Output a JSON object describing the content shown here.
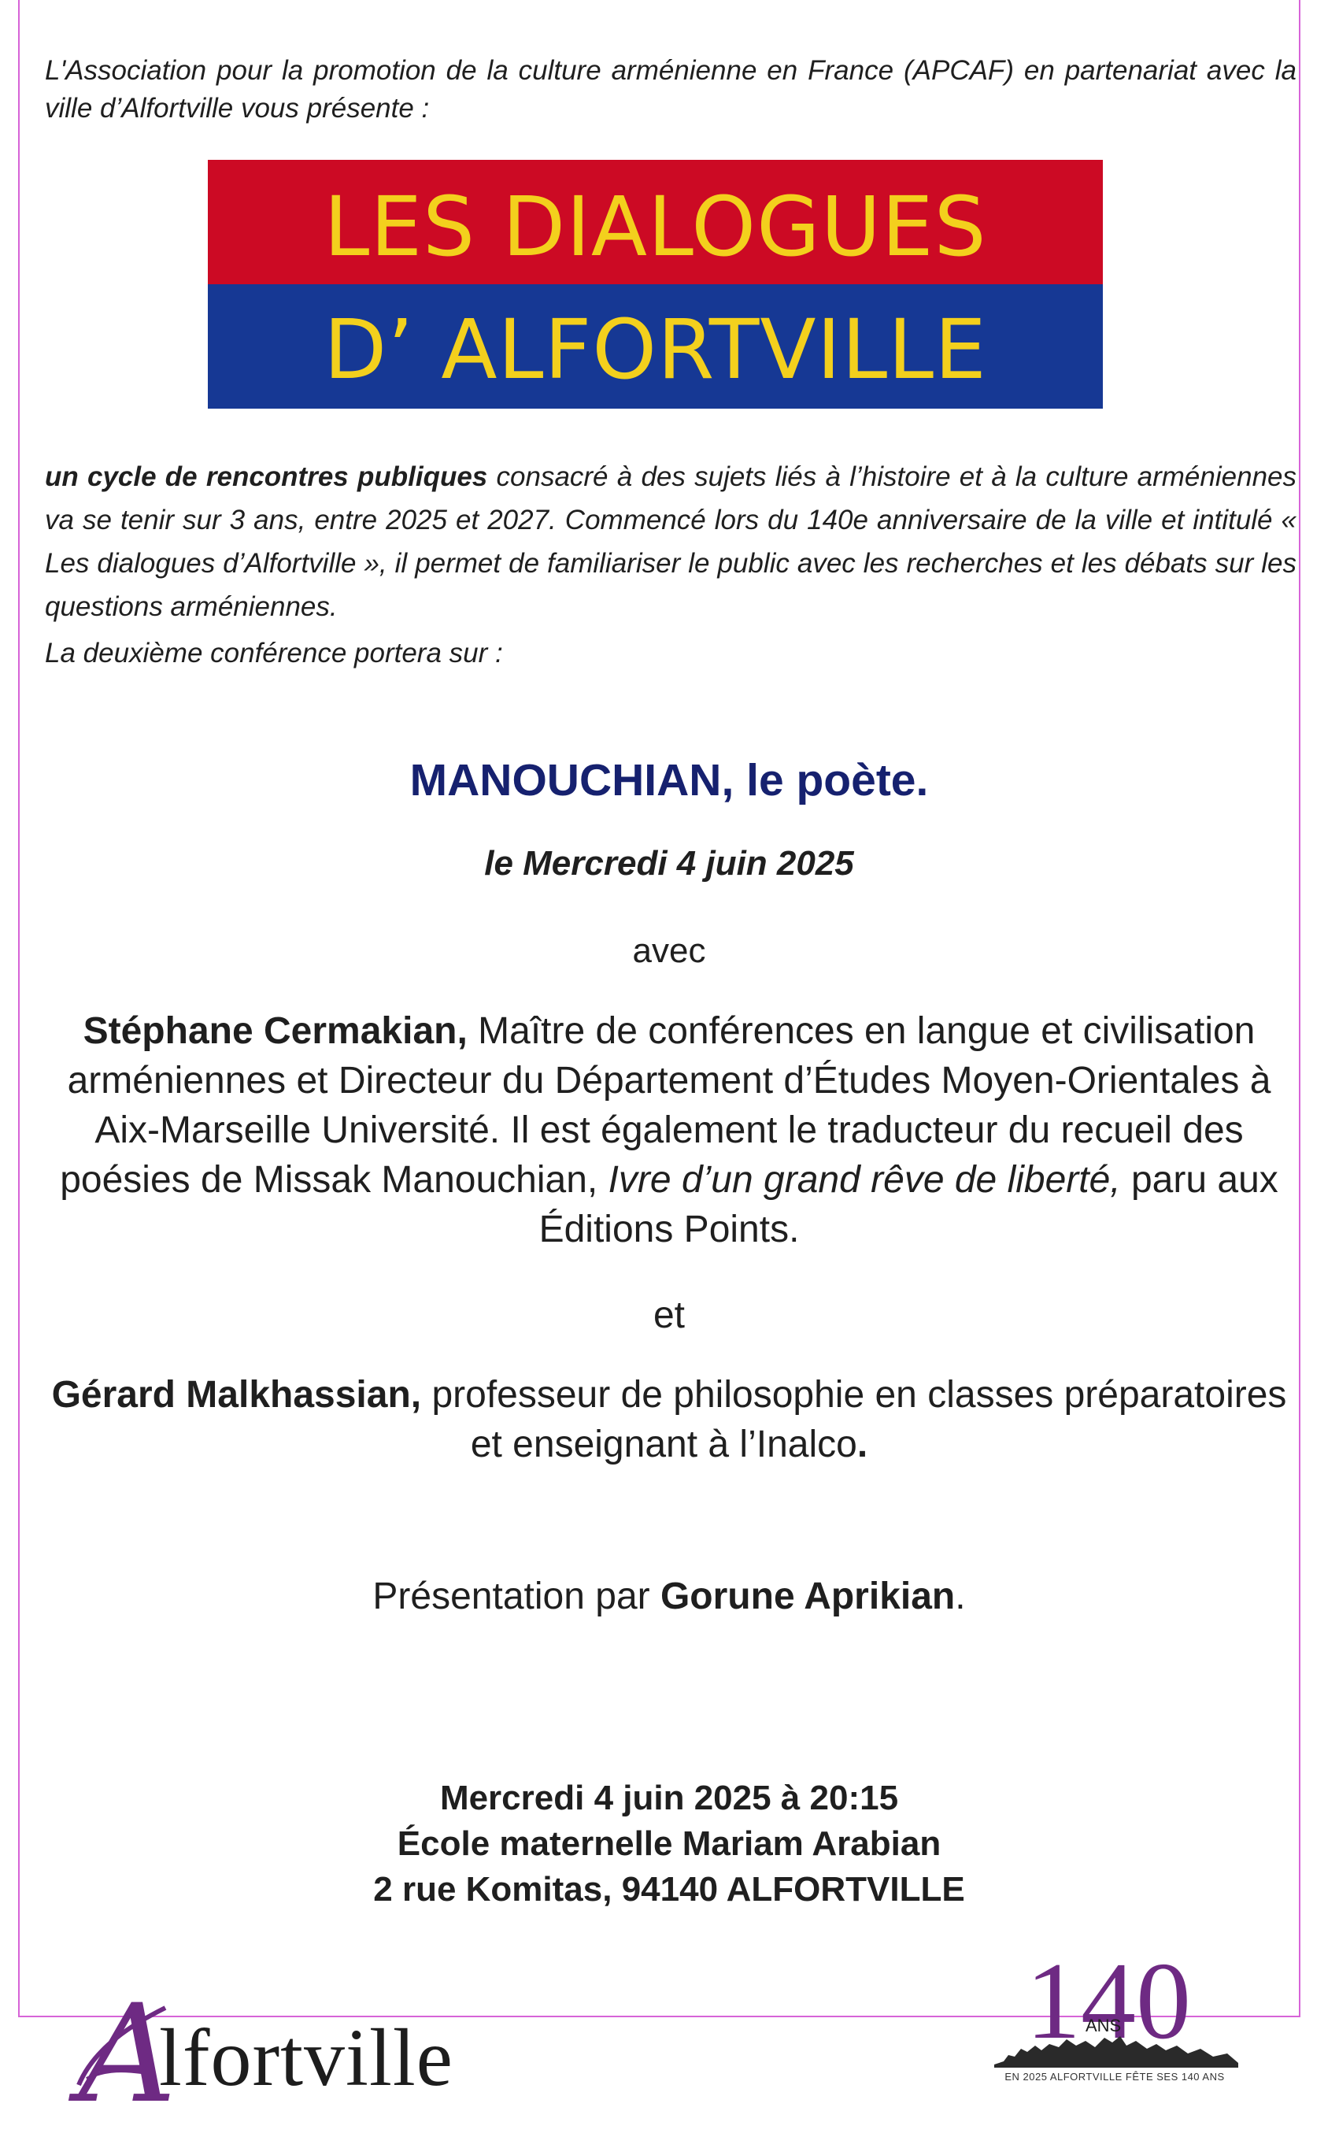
{
  "intro": "L'Association pour la promotion de la culture arménienne en France (APCAF) en partenariat avec la ville d’Alfortville vous présente :",
  "banner": {
    "line1": "LES DIALOGUES",
    "line2": "D’ ALFORTVILLE",
    "colors": {
      "top": "#cc0a24",
      "bottom": "#163894",
      "text": "#f3d01d"
    }
  },
  "description": {
    "bold_lead": "un cycle de rencontres publiques",
    "text": " consacré à des sujets liés à l’histoire et à la culture arméniennes va se tenir sur 3 ans, entre 2025 et 2027. Commencé lors du 140e anniversaire de la ville et intitulé « Les dialogues d’Alfortville », il permet de familiariser le public avec les recherches et les débats sur les questions arméniennes."
  },
  "second_conference": "La deuxième conférence portera sur :",
  "title": "MANOUCHIAN, le poète.",
  "date": "le Mercredi 4 juin 2025",
  "avec": "avec",
  "speaker1": {
    "name": "Stéphane Cermakian,",
    "bio1": " Maître de conférences en langue et civilisation arméniennes et Directeur du Département d’Études Moyen-Orientales à Aix-Marseille Université. Il est également le traducteur du recueil des poésies de Missak Manouchian, ",
    "book": "Ivre d’un grand rêve de liberté,",
    "bio2": " paru aux Éditions Points."
  },
  "et": "et",
  "speaker2": {
    "name": "Gérard Malkhassian,",
    "bio": " professeur de philosophie en classes préparatoires et enseignant à l’Inalco",
    "end": "."
  },
  "presentation": {
    "prefix": "Présentation par ",
    "name": "Gorune Aprikian",
    "suffix": "."
  },
  "event": {
    "when": "Mercredi 4 juin 2025 à 20:15",
    "venue": "École maternelle Mariam Arabian",
    "address": "2 rue Komitas, 94140 ALFORTVILLE"
  },
  "logos": {
    "city_initial": "A",
    "city_rest": "lfortville",
    "anniv_number": "140",
    "anniv_ans": "ANS",
    "anniv_tagline": "EN 2025 ALFORTVILLE FÊTE SES 140 ANS"
  },
  "colors": {
    "frame": "#d764d8",
    "title": "#16216f",
    "logo_purple": "#6e2a83"
  }
}
